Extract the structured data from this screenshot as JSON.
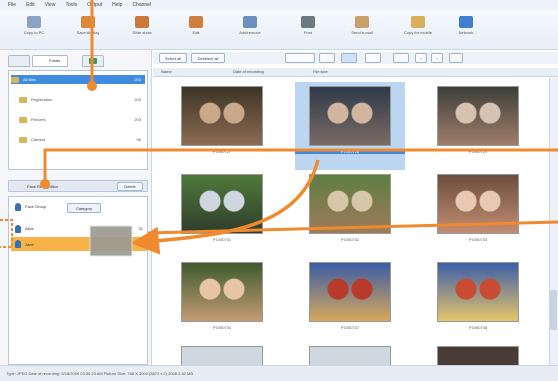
{
  "menu": [
    "File",
    "Edit",
    "View",
    "Tools",
    "Output",
    "Help",
    "Channel"
  ],
  "toolbar": [
    {
      "label": "Copy to PC",
      "icon": "camera-to-pc-icon",
      "color": "#8aa3c4"
    },
    {
      "label": "Save/display",
      "icon": "save-display-icon",
      "color": "#d9873a"
    },
    {
      "label": "Slide show",
      "icon": "slide-show-icon",
      "color": "#c97a3a"
    },
    {
      "label": "Edit",
      "icon": "edit-icon",
      "color": "#d07d3c"
    },
    {
      "label": "Add/remove",
      "icon": "add-remove-icon",
      "color": "#6b8fbf"
    },
    {
      "label": "Print",
      "icon": "print-icon",
      "color": "#6f7783"
    },
    {
      "label": "Send e-mail",
      "icon": "mail-icon",
      "color": "#c9a06a"
    },
    {
      "label": "Copy for mobile",
      "icon": "copy-mobile-icon",
      "color": "#d7b15a"
    },
    {
      "label": "Network",
      "icon": "network-icon",
      "color": "#3f7fcf"
    }
  ],
  "left_tabs": [
    "Folder"
  ],
  "folder_tree": [
    {
      "label": "All files",
      "count": "203",
      "selected": true
    },
    {
      "label": "Registration",
      "count": "203",
      "selected": false
    },
    {
      "label": "Pictures",
      "count": "203",
      "selected": false
    },
    {
      "label": "Camera",
      "count": "96",
      "selected": false
    }
  ],
  "person_panel": {
    "header": "Face Recognition",
    "button": "Delete"
  },
  "persons": [
    {
      "label": "Face Group",
      "count": "",
      "highlight": false
    },
    {
      "label": "Alice",
      "count": "31",
      "highlight": false
    },
    {
      "label": "Jane",
      "count": "",
      "highlight": true
    }
  ],
  "category_button": "Category",
  "viewbar": {
    "select_all": "Select all",
    "deselect_all": "Deselect all"
  },
  "columns": [
    "Name",
    "Date of recording",
    "File size"
  ],
  "photos": [
    {
      "name": "P1000727",
      "selected": false,
      "palette": [
        "#3c3526",
        "#8d6b52",
        "#c9a98a"
      ]
    },
    {
      "name": "P1000728",
      "selected": true,
      "palette": [
        "#2f3a4a",
        "#7a6a63",
        "#d2b59f"
      ]
    },
    {
      "name": "P1000729",
      "selected": false,
      "palette": [
        "#3d4038",
        "#a07d6b",
        "#d5c2b0"
      ]
    },
    {
      "name": "P1000731",
      "selected": false,
      "palette": [
        "#4f7a3a",
        "#2f3d2c",
        "#cfd6e0"
      ]
    },
    {
      "name": "P1000732",
      "selected": false,
      "palette": [
        "#5d7e42",
        "#9f7b5a",
        "#d5c7a8"
      ]
    },
    {
      "name": "P1000733",
      "selected": false,
      "palette": [
        "#6b4e3c",
        "#c28d73",
        "#e7c9b3"
      ]
    },
    {
      "name": "P1000734",
      "selected": false,
      "palette": [
        "#3f5a2e",
        "#c49b74",
        "#e6c5a5"
      ]
    },
    {
      "name": "P1000737",
      "selected": false,
      "palette": [
        "#3a5da5",
        "#d7a85b",
        "#b83a2b"
      ]
    },
    {
      "name": "P1000738",
      "selected": false,
      "palette": [
        "#3c5fa8",
        "#e6c46a",
        "#c84b33"
      ]
    }
  ],
  "status": "Type: JPEG   Date of recording: 5/15/2009 03:00:23 AM   Picture Size: 768 X 3000 (3872 x 2)   2048   2.62 MB"
}
